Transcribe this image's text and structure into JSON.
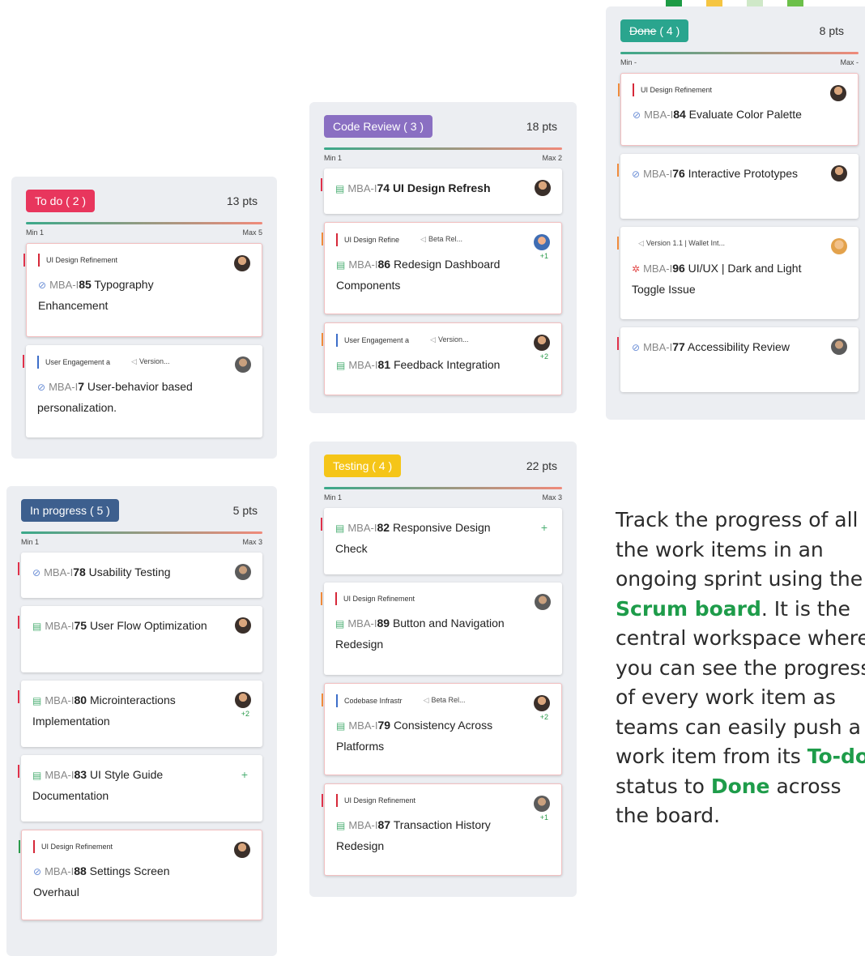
{
  "deco_colors": [
    "#1d9b45",
    "#f5c542",
    "#cfe8c8",
    "#6cc04a"
  ],
  "columns": {
    "todo": {
      "badge_name": "To do",
      "badge_count": "( 2 )",
      "badge_color": "#e8365d",
      "points": "13 pts",
      "min": "Min 1",
      "max": "Max 5",
      "cards": [
        {
          "tags": [
            "UI Design Refinement"
          ],
          "key": "MBA-I",
          "num": "85",
          "title": "Typography Enhancement"
        },
        {
          "tags": [
            "User Engagement a",
            "Version..."
          ],
          "key": "MBA-I",
          "num": "7",
          "title": "User-behavior based personalization."
        }
      ]
    },
    "inprogress": {
      "badge_name": "In progress",
      "badge_count": "( 5 )",
      "badge_color": "#3d5f8e",
      "points": "5 pts",
      "min": "Min 1",
      "max": "Max 3",
      "cards": [
        {
          "key": "MBA-I",
          "num": "78",
          "title": "Usability Testing"
        },
        {
          "key": "MBA-I",
          "num": "75",
          "title": "User Flow Optimization"
        },
        {
          "key": "MBA-I",
          "num": "80",
          "title": "Microinteractions Implementation",
          "extra": "+2"
        },
        {
          "key": "MBA-I",
          "num": "83",
          "title": "UI Style Guide Documentation"
        },
        {
          "tags": [
            "UI Design Refinement"
          ],
          "key": "MBA-I",
          "num": "88",
          "title": "Settings Screen Overhaul"
        }
      ]
    },
    "codereview": {
      "badge_name": "Code Review",
      "badge_count": "( 3 )",
      "badge_color": "#8a6fc2",
      "points": "18 pts",
      "min": "Min 1",
      "max": "Max 2",
      "cards": [
        {
          "key": "MBA-I",
          "num": "74",
          "title": "UI Design Refresh"
        },
        {
          "tags": [
            "UI Design Refine",
            "Beta Rel..."
          ],
          "key": "MBA-I",
          "num": "86",
          "title": "Redesign Dashboard Components",
          "extra": "+1"
        },
        {
          "tags": [
            "User Engagement a",
            "Version..."
          ],
          "key": "MBA-I",
          "num": "81",
          "title": "Feedback Integration",
          "extra": "+2"
        }
      ]
    },
    "testing": {
      "badge_name": "Testing",
      "badge_count": "( 4 )",
      "badge_color": "#f5c518",
      "points": "22 pts",
      "min": "Min 1",
      "max": "Max 3",
      "cards": [
        {
          "key": "MBA-I",
          "num": "82",
          "title": "Responsive Design Check"
        },
        {
          "tags": [
            "UI Design Refinement"
          ],
          "key": "MBA-I",
          "num": "89",
          "title": "Button and Navigation Redesign"
        },
        {
          "tags": [
            "Codebase Infrastr",
            "Beta Rel..."
          ],
          "key": "MBA-I",
          "num": "79",
          "title": "Consistency Across Platforms",
          "extra": "+2"
        },
        {
          "tags": [
            "UI Design Refinement"
          ],
          "key": "MBA-I",
          "num": "87",
          "title": "Transaction History Redesign",
          "extra": "+1"
        }
      ]
    },
    "done": {
      "badge_name": "Done",
      "badge_count": "( 4 )",
      "badge_color": "#2aa58e",
      "points": "8 pts",
      "min": "Min -",
      "max": "Max -",
      "cards": [
        {
          "tags": [
            "UI Design Refinement"
          ],
          "key": "MBA-I",
          "num": "84",
          "title": "Evaluate Color Palette"
        },
        {
          "key": "MBA-I",
          "num": "76",
          "title": "Interactive Prototypes"
        },
        {
          "tags": [
            "Version 1.1 | Wallet Int..."
          ],
          "key": "MBA-I",
          "num": "96",
          "title": "UI/UX | Dark and Light Toggle Issue"
        },
        {
          "key": "MBA-I",
          "num": "77",
          "title": "Accessibility Review"
        }
      ]
    }
  },
  "description": {
    "p1": "Track the progress of all the work items in an ongoing sprint using the ",
    "b1": "Scrum board",
    "p2": ". It is the central workspace where you can see the progress of every work item as teams can easily push a work item from its ",
    "b2": "To-do",
    "p3": " status to ",
    "b3": "Done",
    "p4": " across the board."
  }
}
